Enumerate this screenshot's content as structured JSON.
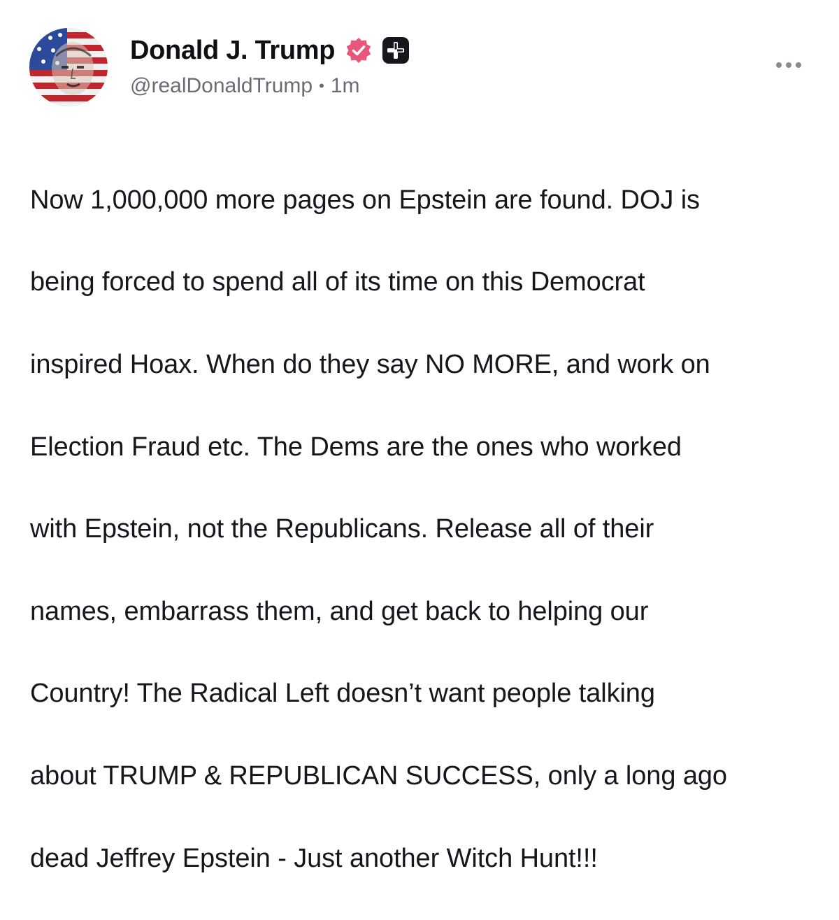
{
  "post": {
    "author": {
      "display_name": "Donald J. Trump",
      "handle": "@realDonaldTrump",
      "separator": "•",
      "time_ago": "1m",
      "verified_icon": "verified-badge-icon",
      "verified_color": "#e8577a",
      "plus_badge_icon": "plus-badge-icon",
      "avatar": "avatar-image"
    },
    "more_menu_icon": "ellipsis-icon",
    "body_lines": [
      "Now 1,000,000 more pages on Epstein are found. DOJ is",
      "being forced to spend all of its time on this Democrat",
      "inspired Hoax. When do they say NO MORE, and work on",
      "Election Fraud etc. The Dems are the ones who worked",
      "with Epstein, not the Republicans. Release all of their",
      "names, embarrass them, and get back to helping our",
      "Country! The Radical Left doesn’t want people talking",
      "about TRUMP & REPUBLICAN SUCCESS, only a long ago",
      "dead Jeffrey Epstein - Just another Witch Hunt!!!"
    ]
  }
}
